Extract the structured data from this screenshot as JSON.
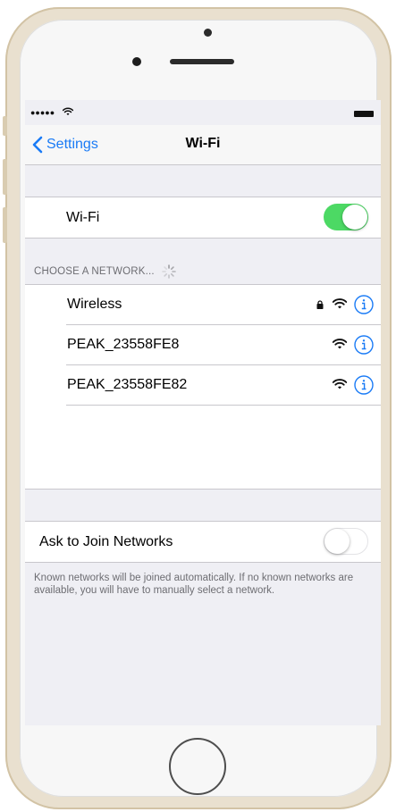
{
  "status_bar": {
    "signal_icon": "signal-dots-icon",
    "wifi_icon": "wifi-icon",
    "battery_icon": "battery-icon"
  },
  "nav": {
    "back_label": "Settings",
    "title": "Wi-Fi"
  },
  "wifi_toggle": {
    "label": "Wi-Fi",
    "state": "on"
  },
  "networks_section": {
    "header": "CHOOSE A NETWORK...",
    "networks": [
      {
        "name": "Wireless",
        "secured": true
      },
      {
        "name": "PEAK_23558FE8",
        "secured": false
      },
      {
        "name": "PEAK_23558FE82",
        "secured": false
      }
    ]
  },
  "ask_to_join": {
    "label": "Ask to Join Networks",
    "state": "off",
    "footer": "Known networks will be joined automatically. If no known networks are available, you will have to manually select a network."
  },
  "colors": {
    "accent": "#1a7bf6",
    "toggle_on": "#4cd964",
    "background": "#efeff4"
  }
}
